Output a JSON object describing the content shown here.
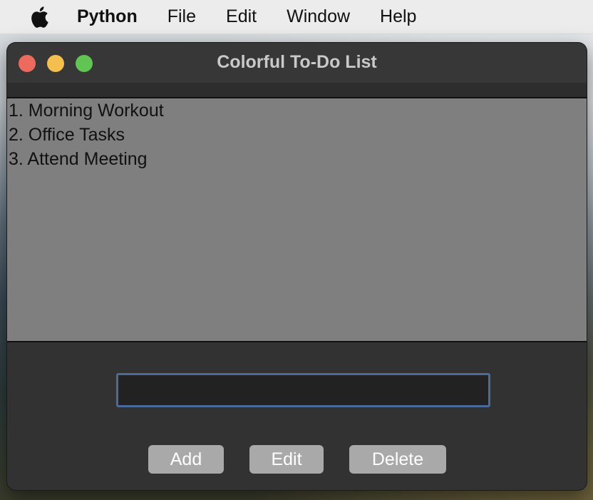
{
  "menubar": {
    "apple_icon": "apple-logo-icon",
    "items": [
      "Python",
      "File",
      "Edit",
      "Window",
      "Help"
    ]
  },
  "window": {
    "title": "Colorful To-Do List",
    "controls": {
      "close_color": "#ed6a5e",
      "minimize_color": "#f5bf4f",
      "maximize_color": "#61c554"
    }
  },
  "todo_list": {
    "items": [
      "1. Morning Workout",
      "2. Office Tasks",
      "3. Attend Meeting"
    ]
  },
  "task_entry": {
    "value": "",
    "placeholder": ""
  },
  "buttons": {
    "add_label": "Add",
    "edit_label": "Edit",
    "delete_label": "Delete"
  },
  "colors": {
    "list_background": "#7f7f7f",
    "window_background": "#323232",
    "button_background": "#a9a9a9",
    "entry_border": "#4a6a9c"
  }
}
